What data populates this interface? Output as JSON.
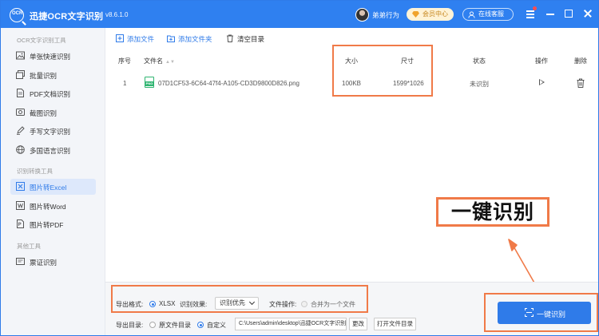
{
  "app": {
    "title": "迅捷OCR文字识别",
    "version": "v8.6.1.0",
    "logo_text": "OCR"
  },
  "header": {
    "username": "弟弟行为",
    "vip_label": "会员中心",
    "service_label": "在线客服"
  },
  "sidebar": {
    "section1_title": "OCR文字识别工具",
    "section1_items": [
      {
        "label": "单张快速识别",
        "icon": "image-icon"
      },
      {
        "label": "批量识别",
        "icon": "batch-icon"
      },
      {
        "label": "PDF文档识别",
        "icon": "pdf-doc-icon"
      },
      {
        "label": "截图识别",
        "icon": "screenshot-icon"
      },
      {
        "label": "手写文字识别",
        "icon": "pen-icon"
      },
      {
        "label": "多国语言识别",
        "icon": "globe-icon"
      }
    ],
    "section2_title": "识别转换工具",
    "section2_items": [
      {
        "label": "图片转Excel",
        "icon": "excel-icon",
        "active": true
      },
      {
        "label": "图片转Word",
        "icon": "word-icon"
      },
      {
        "label": "图片转PDF",
        "icon": "pdf-icon"
      }
    ],
    "section3_title": "其他工具",
    "section3_items": [
      {
        "label": "票证识别",
        "icon": "ticket-icon"
      }
    ]
  },
  "toolbar": {
    "add_file": "添加文件",
    "add_folder": "添加文件夹",
    "clear_list": "清空目录"
  },
  "table": {
    "columns": {
      "index": "序号",
      "filename": "文件名",
      "size": "大小",
      "dimensions": "尺寸",
      "status": "状态",
      "action": "操作",
      "delete": "删除"
    },
    "rows": [
      {
        "index": "1",
        "filename": "07D1CF53-6C64-47f4-A105-CD3D9800D826.png",
        "file_type": "PNG",
        "size": "100KB",
        "dimensions": "1599*1026",
        "status": "未识别"
      }
    ]
  },
  "annotation": {
    "big_label": "一键识别",
    "color": "#f07a48"
  },
  "bottom": {
    "format_label": "导出格式:",
    "format_option": "XLSX",
    "effect_label": "识别效果:",
    "effect_value": "识别优先",
    "file_op_label": "文件操作:",
    "merge_option": "合并为一个文件",
    "output_label": "导出目录:",
    "original_dir": "原文件目录",
    "custom_dir": "自定义",
    "path": "C:\\Users\\admin\\desktop\\迅捷OCR文字识别",
    "change_btn": "更改",
    "open_dir_btn": "打开文件目录",
    "start_btn": "一键识别"
  },
  "colors": {
    "primary": "#2f7be9",
    "titlebar": "#2f80f0",
    "highlight": "#f07a48"
  }
}
